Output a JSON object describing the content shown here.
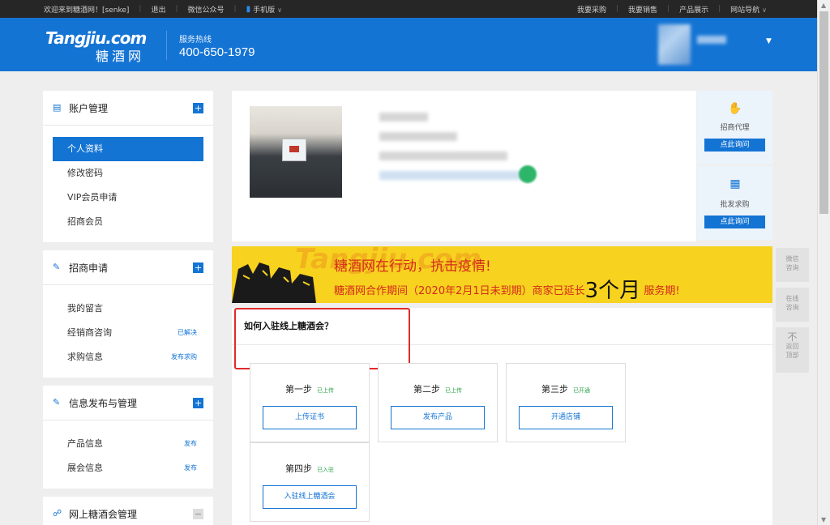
{
  "topbar": {
    "welcome": "欢迎来到糖酒网！[senke]",
    "logout": "退出",
    "wechat": "微信公众号",
    "mobile": "手机版",
    "right": [
      "我要采购",
      "我要销售",
      "产品展示",
      "网站导航"
    ]
  },
  "header": {
    "logo_en": "Tangjiu.com",
    "logo_cn": "糖酒网",
    "hotline_label": "服务热线",
    "hotline_number": "400-650-1979"
  },
  "sidebar": {
    "groups": [
      {
        "title": "账户管理",
        "toggle": "+",
        "items": [
          {
            "label": "个人资料",
            "tag": ""
          },
          {
            "label": "修改密码",
            "tag": ""
          },
          {
            "label": "VIP会员申请",
            "tag": ""
          },
          {
            "label": "招商会员",
            "tag": ""
          }
        ]
      },
      {
        "title": "招商申请",
        "toggle": "+",
        "items": [
          {
            "label": "我的留言",
            "tag": ""
          },
          {
            "label": "经销商咨询",
            "tag": "已解决"
          },
          {
            "label": "求购信息",
            "tag": "发布求购"
          }
        ]
      },
      {
        "title": "信息发布与管理",
        "toggle": "+",
        "items": [
          {
            "label": "产品信息",
            "tag": "发布"
          },
          {
            "label": "展会信息",
            "tag": "发布"
          }
        ]
      },
      {
        "title": "网上糖酒会管理",
        "toggle": "−",
        "items": []
      }
    ]
  },
  "side_cards": [
    {
      "label": "招商代理",
      "button": "点此询问"
    },
    {
      "label": "批发求购",
      "button": "点此询问"
    }
  ],
  "banner": {
    "watermark": "Tangjiu.com",
    "line1": "糖酒网在行动，抗击疫情!",
    "line2_pre": "糖酒网合作期间（2020年2月1日未到期）商家已延长",
    "line2_big": "3个月",
    "line2_post": "服务期!"
  },
  "steps": {
    "title": "如何入驻线上糖酒会？",
    "items": [
      {
        "name": "第一步",
        "status": "已上传",
        "button": "上传证书"
      },
      {
        "name": "第二步",
        "status": "已上传",
        "button": "发布产品"
      },
      {
        "name": "第三步",
        "status": "已开通",
        "button": "开通店铺"
      },
      {
        "name": "第四步",
        "status": "已入驻",
        "button": "入驻线上糖酒会"
      }
    ]
  },
  "float_tools": [
    {
      "label_1": "微信",
      "label_2": "咨询"
    },
    {
      "label_1": "在线",
      "label_2": "咨询"
    },
    {
      "arrow": "不",
      "label_1": "返回",
      "label_2": "顶部"
    }
  ],
  "icons": {
    "accent": "#1474d4",
    "status_green": "#2aa34a",
    "banner_red": "#d42a1a",
    "banner_yellow": "#f7d21f"
  }
}
